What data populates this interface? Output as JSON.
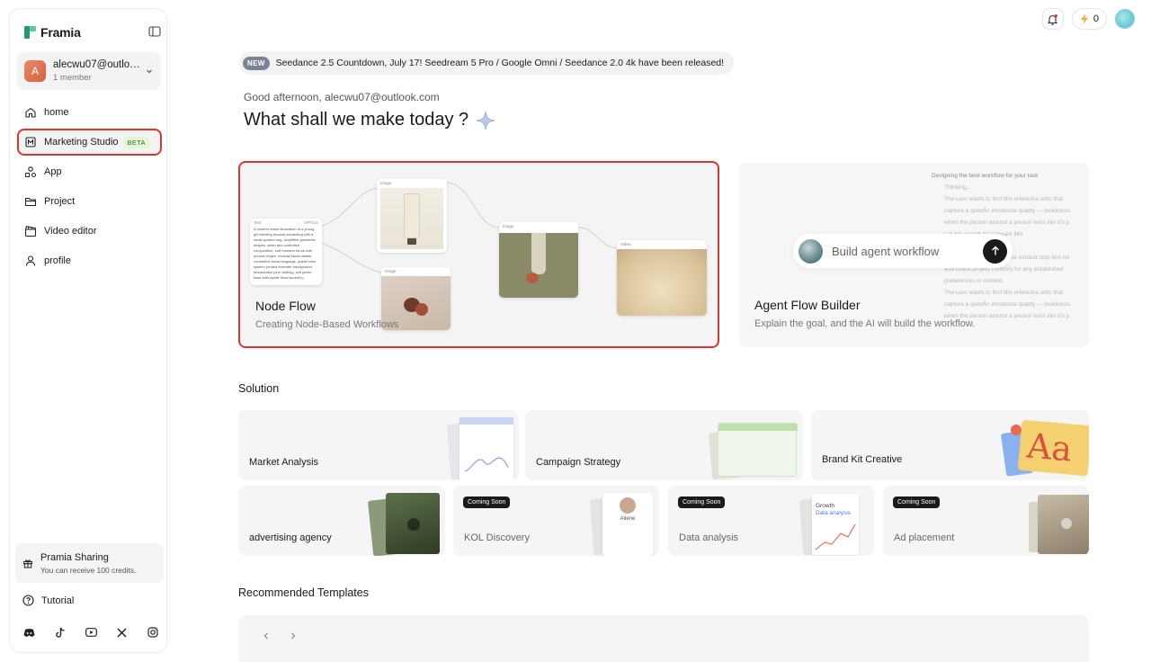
{
  "app": {
    "name": "Framia"
  },
  "account": {
    "initial": "A",
    "email": "alecwu07@outloo...",
    "members": "1 member"
  },
  "nav": [
    {
      "label": "home",
      "icon": "home-icon"
    },
    {
      "label": "Marketing Studio",
      "icon": "marketing-icon",
      "badge": "BETA"
    },
    {
      "label": "App",
      "icon": "app-icon"
    },
    {
      "label": "Project",
      "icon": "folder-icon"
    },
    {
      "label": "Video editor",
      "icon": "clapper-icon"
    },
    {
      "label": "profile",
      "icon": "user-icon"
    }
  ],
  "sharing": {
    "title": "Pramia Sharing",
    "subtitle": "You can receive 100 credits."
  },
  "tutorial": {
    "label": "Tutorial"
  },
  "socials": [
    "discord-icon",
    "tiktok-icon",
    "youtube-icon",
    "x-icon",
    "instagram-icon"
  ],
  "topbar": {
    "credits": "0"
  },
  "announcement": {
    "badge": "NEW",
    "text": "Seedance 2.5 Countdown, July 17! Seedream 5 Pro / Google Omni / Seedance 2.0 4k have been released!"
  },
  "greeting": "Good afternoon, alecwu07@outlook.com",
  "headline": "What shall we make today ?",
  "cards": {
    "node_flow": {
      "title": "Node Flow",
      "subtitle": "Creating Node-Based Workflows",
      "nodes": {
        "text_hdr": "Text",
        "text_tag": "OPTILS",
        "text_body": "A modern brand illustration of a young girl bending forward interacting with a small spotted dog, simplified geometric shapes, clean and controlled composition, soft rounded forms with precise edges, minimal facial details, consistent visual language, pastel color system (muted lavender background, desaturated pink clothing, soft green base with subtle floral accents)...",
        "image1": "Image",
        "image2": "Image",
        "image3": "Image",
        "video": "Video"
      }
    },
    "agent_flow": {
      "title": "Agent Flow Builder",
      "subtitle": "Explain the goal, and the AI will build the workflow.",
      "placeholder": "Build agent workflow",
      "bg_lead": "Designing the best workflow for your task",
      "bg_thinking": "Thinking...",
      "bg_lines": [
        "The user wants to find film reference stills that",
        "capture a specific emotional quality — loneliness",
        "when the person around a person feels like it's p",
        "Let me search for relevant film",
        "Let me also quickly read the context strip text no",
        "and check project memory for any established",
        "preferences or context.",
        "The user wants to find film reference stills that",
        "capture a specific emotional quality — loneliness",
        "when the person around a person feels like it's p"
      ]
    }
  },
  "solution": {
    "title": "Solution",
    "row1": [
      {
        "label": "Market Analysis"
      },
      {
        "label": "Campaign Strategy"
      },
      {
        "label": "Brand Kit Creative",
        "art_text": "Aa"
      }
    ],
    "row2": [
      {
        "label": "advertising agency"
      },
      {
        "label": "KOL Discovery",
        "badge": "Coming Soon",
        "art_name": "Aliene"
      },
      {
        "label": "Data analysis",
        "badge": "Coming Soon",
        "art_title1": "Growth",
        "art_title2": "Data analysis"
      },
      {
        "label": "Ad placement",
        "badge": "Coming Soon"
      }
    ]
  },
  "templates": {
    "title": "Recommended Templates"
  }
}
